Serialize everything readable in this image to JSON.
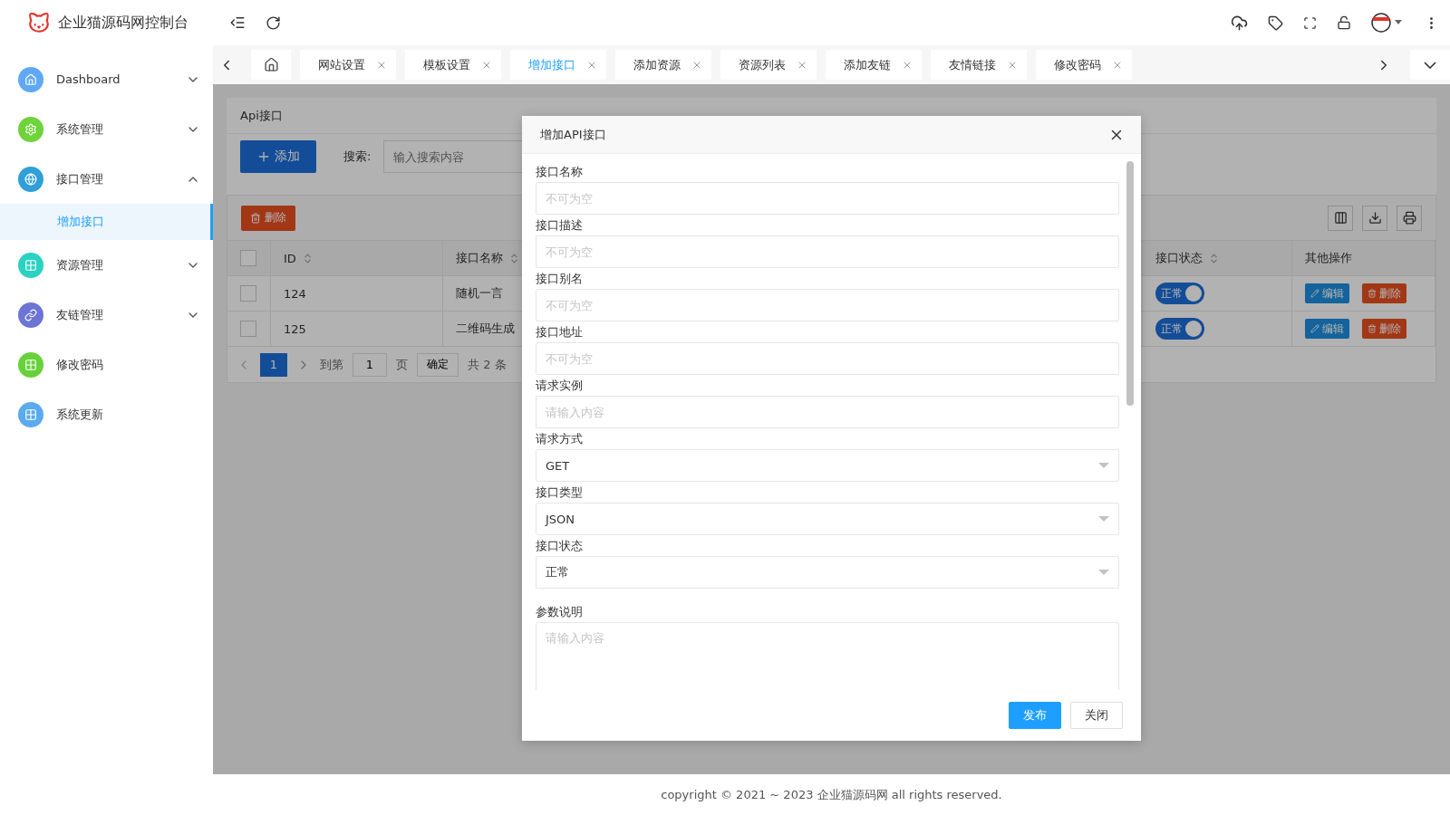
{
  "app": {
    "title": "企业猫源码网控制台"
  },
  "sidebar": {
    "items": [
      {
        "label": "Dashboard",
        "color": "#5fa8f5",
        "expanded": false,
        "selected": false
      },
      {
        "label": "系统管理",
        "color": "#6fd33a",
        "expanded": false,
        "selected": false
      },
      {
        "label": "接口管理",
        "color": "#2f9fd8",
        "expanded": true,
        "selected": false,
        "children": [
          {
            "label": "增加接口",
            "selected": true
          }
        ]
      },
      {
        "label": "资源管理",
        "color": "#2bd1c1",
        "expanded": false,
        "selected": false
      },
      {
        "label": "友链管理",
        "color": "#6c74d6",
        "expanded": false,
        "selected": false
      },
      {
        "label": "修改密码",
        "color": "#67d13a",
        "selected": false
      },
      {
        "label": "系统更新",
        "color": "#5aaaf0",
        "selected": false
      }
    ]
  },
  "tabs": [
    {
      "label": "网站设置",
      "selected": false
    },
    {
      "label": "模板设置",
      "selected": false
    },
    {
      "label": "增加接口",
      "selected": true
    },
    {
      "label": "添加资源",
      "selected": false
    },
    {
      "label": "资源列表",
      "selected": false
    },
    {
      "label": "添加友链",
      "selected": false
    },
    {
      "label": "友情链接",
      "selected": false
    },
    {
      "label": "修改密码",
      "selected": false
    }
  ],
  "panel": {
    "title": "Api接口",
    "add_button": "添加",
    "search_label": "搜索:",
    "search_placeholder": "输入搜索内容",
    "delete_button": "删除"
  },
  "table": {
    "columns": [
      {
        "label": "ID",
        "sortable": true
      },
      {
        "label": "接口名称",
        "sortable": true
      },
      {
        "label": "接口状态",
        "sortable": true
      },
      {
        "label": "其他操作",
        "sortable": false
      }
    ],
    "all_checked": false,
    "rows": [
      {
        "checked": false,
        "id": "124",
        "name": "随机一言",
        "status": "正常",
        "on": true,
        "edit": "编辑",
        "delete": "删除"
      },
      {
        "checked": false,
        "id": "125",
        "name": "二维码生成",
        "status": "正常",
        "on": true,
        "edit": "编辑",
        "delete": "删除"
      }
    ]
  },
  "pagination": {
    "pages": [
      {
        "label": "1",
        "selected": true
      }
    ],
    "goto_label": "到第",
    "goto_value": "1",
    "page_label": "页",
    "confirm": "确定",
    "total": "共 2 条"
  },
  "dialog": {
    "title": "增加API接口",
    "fields": [
      {
        "kind": "input",
        "label": "接口名称",
        "placeholder": "不可为空"
      },
      {
        "kind": "input",
        "label": "接口描述",
        "placeholder": "不可为空"
      },
      {
        "kind": "input",
        "label": "接口别名",
        "placeholder": "不可为空"
      },
      {
        "kind": "input",
        "label": "接口地址",
        "placeholder": "不可为空"
      },
      {
        "kind": "input",
        "label": "请求实例",
        "placeholder": "请输入内容"
      },
      {
        "kind": "select",
        "label": "请求方式",
        "value": "GET"
      },
      {
        "kind": "select",
        "label": "接口类型",
        "value": "JSON"
      },
      {
        "kind": "select",
        "label": "接口状态",
        "value": "正常"
      },
      {
        "kind": "textarea",
        "label": "参数说明",
        "placeholder": "请输入内容"
      }
    ],
    "buttons": [
      {
        "label": "发布",
        "primary": true
      },
      {
        "label": "关闭",
        "primary": false
      }
    ]
  },
  "footer": "copyright © 2021 ~ 2023 企业猫源码网 all rights reserved."
}
